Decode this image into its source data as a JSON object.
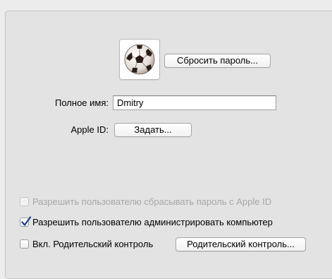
{
  "user": {
    "reset_password_button": "Сбросить пароль...",
    "full_name_label": "Полное имя:",
    "full_name_value": "Dmitry",
    "apple_id_label": "Apple ID:",
    "apple_id_set_button": "Задать..."
  },
  "options": {
    "allow_reset_with_apple_id": {
      "label": "Разрешить пользователю сбрасывать пароль с Apple ID",
      "checked": false,
      "enabled": false
    },
    "allow_admin": {
      "label": "Разрешить пользователю администрировать компьютер",
      "checked": true,
      "enabled": true
    },
    "parental_controls": {
      "label": "Вкл. Родительский контроль",
      "checked": false,
      "enabled": true,
      "button": "Родительский контроль..."
    }
  },
  "icons": {
    "avatar": "soccer-ball-icon",
    "check": "checkmark-icon"
  },
  "colors": {
    "checkmark": "#1a3f8a",
    "disabled_text": "#a6a6a6"
  }
}
